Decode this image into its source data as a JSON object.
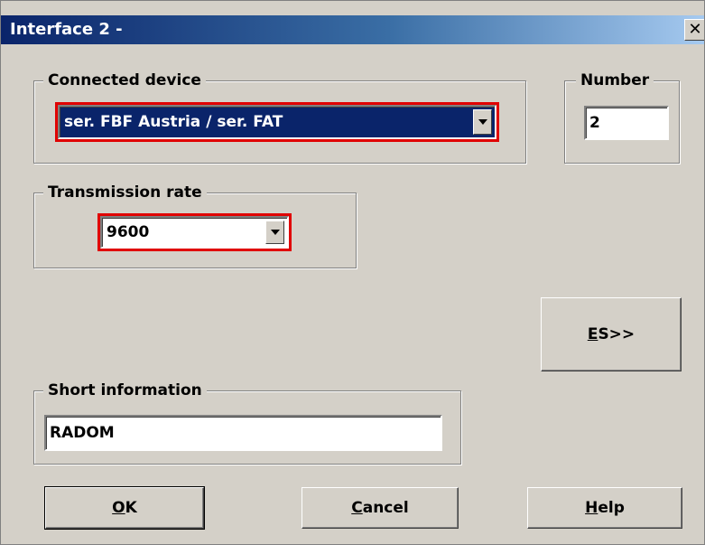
{
  "window": {
    "title": "Interface 2 -",
    "close_icon": "close-icon"
  },
  "connected_device": {
    "label": "Connected device",
    "selected_prefix": "ser. FBF Austria / ser. FAT",
    "highlight_color": "#0a246a",
    "frame_color": "#e00000"
  },
  "number": {
    "label": "Number",
    "value": "2"
  },
  "transmission_rate": {
    "label": "Transmission rate",
    "selected": "9600",
    "frame_color": "#e00000"
  },
  "short_information": {
    "label": "Short information",
    "value": "RADOM"
  },
  "buttons": {
    "es": {
      "mnemonic": "E",
      "rest": "S>>"
    },
    "ok": {
      "mnemonic": "O",
      "rest": "K"
    },
    "cancel": {
      "mnemonic": "C",
      "rest": "ancel"
    },
    "help": {
      "mnemonic": "H",
      "rest": "elp"
    }
  }
}
